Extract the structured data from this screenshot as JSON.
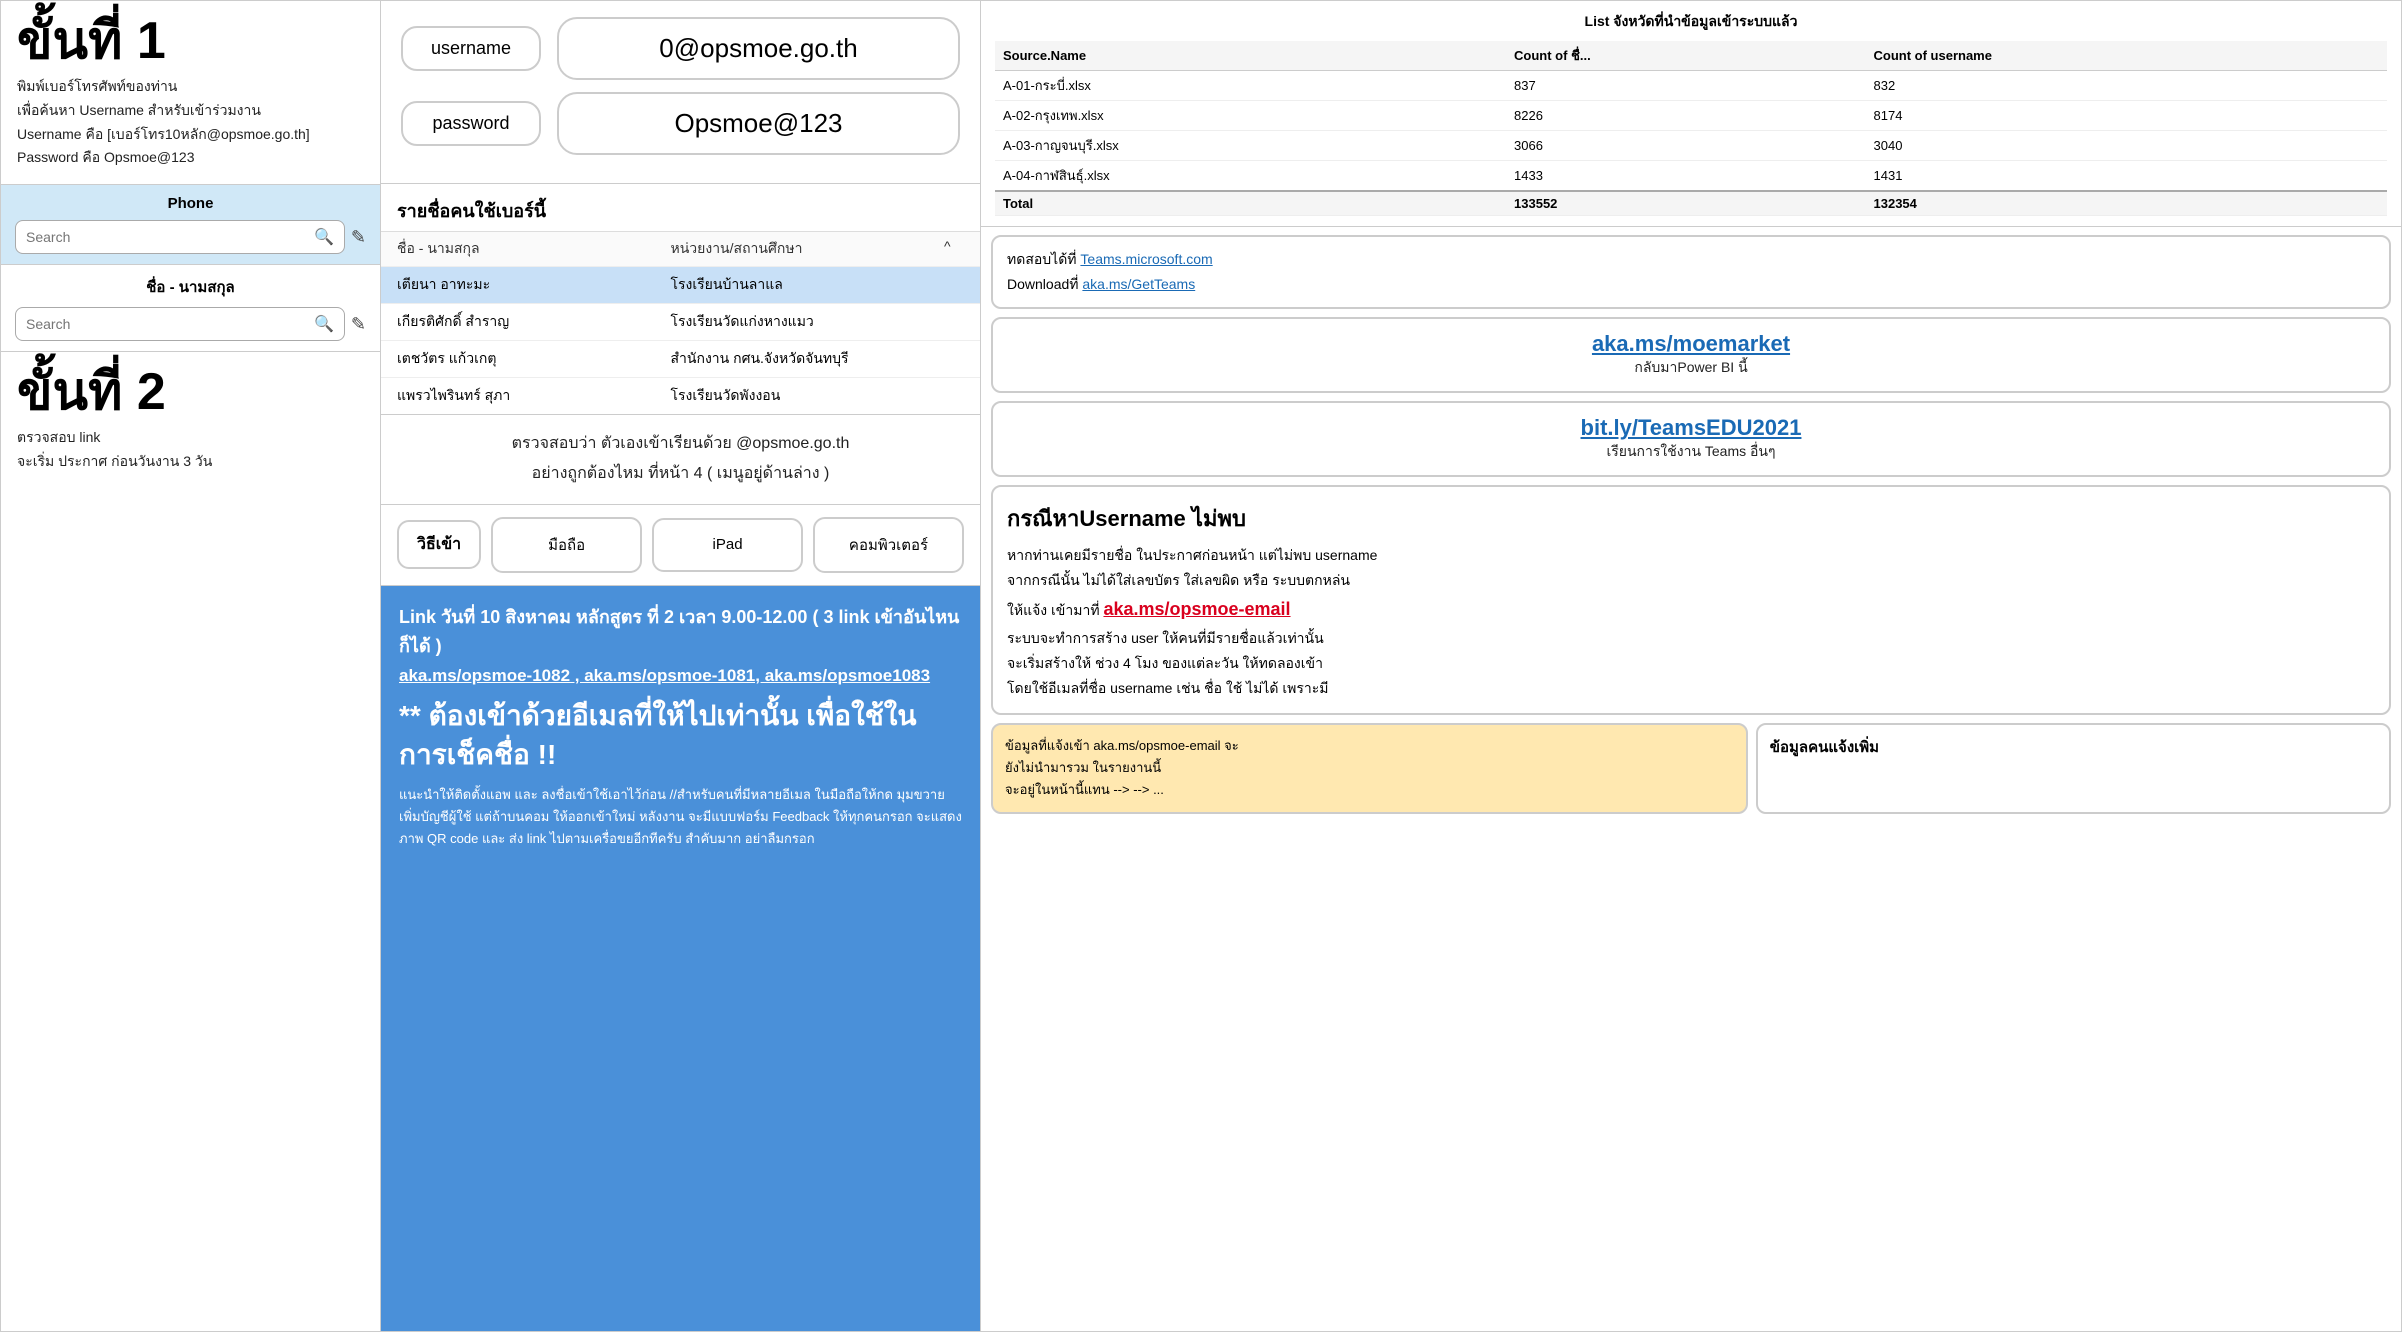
{
  "left": {
    "step1_title": "ขั้นที่ 1",
    "step1_desc_line1": "พิมพ์เบอร์โทรศัพท์ของท่าน",
    "step1_desc_line2": "เพื่อค้นหา Username สำหรับเข้าร่วมงาน",
    "step1_desc_line3": "Username คือ [เบอร์โทร10หลัก@opsmoe.go.th]",
    "step1_desc_line4": "Password คือ Opsmoe@123",
    "phone_label": "Phone",
    "phone_search_placeholder": "Search",
    "name_label": "ชื่อ - นามสกุล",
    "name_search_placeholder": "Search",
    "step2_title": "ขั้นที่ 2",
    "step2_desc_line1": "ตรวจสอบ link",
    "step2_desc_line2": "จะเริ่ม ประกาศ ก่อนวันงาน 3 วัน"
  },
  "mid": {
    "username_label": "username",
    "username_value": "0@opsmoe.go.th",
    "password_label": "password",
    "password_value": "Opsmoe@123",
    "user_list_title": "รายชื่อคนใช้เบอร์นี้",
    "col1": "ชื่อ - นามสกุล",
    "col2": "หน่วยงาน/สถานศึกษา",
    "users": [
      {
        "name": "เตียนา อาทะมะ",
        "org": "โรงเรียนบ้านลาแล",
        "active": true
      },
      {
        "name": "เกียรติศักดิ์ สำราญ",
        "org": "โรงเรียนวัดแก่งหางแมว",
        "active": false
      },
      {
        "name": "เตชวัตร แก้วเกตุ",
        "org": "สำนักงาน กศน.จังหวัดจันทบุรี",
        "active": false
      },
      {
        "name": "แพรวไพรินทร์ สุภา",
        "org": "โรงเรียนวัดพังงอน",
        "active": false
      }
    ],
    "verify_line1": "ตรวจสอบว่า ตัวเองเข้าเรียนด้วย @opsmoe.go.th",
    "verify_line2": "อย่างถูกต้องไหม ที่หน้า 4 ( เมนูอยู่ด้านล่าง )",
    "method_label": "วิธีเข้า",
    "method_mobile": "มือถือ",
    "method_ipad": "iPad",
    "method_computer": "คอมพิวเตอร์",
    "announce_line1": "Link วันที่ 10 สิงหาคม  หลักสูตร ที่ 2 เวลา 9.00-12.00 ( 3 link เข้าอันไหนก็ได้ )",
    "announce_links": "aka.ms/opsmoe-1082 , aka.ms/opsmoe-1081, aka.ms/opsmoe1083",
    "announce_big": "** ต้องเข้าด้วยอีเมลที่ให้ไปเท่านั้น เพื่อใช้ในการเช็คชื่อ !!",
    "announce_small": "แนะนำให้ติดตั้งแอพ และ ลงชื่อเข้าใช้เอาไว้ก่อน //สำหรับคนที่มีหลายอีเมล ในมือถือให้กด มุมขวาย เพิ่มบัญชีผู้ใช้ แต่ถ้าบนคอม ให้ออกเข้าใหม่\nหลังงาน จะมีแบบฟอร์ม Feedback ให้ทุกคนกรอก จะแสดงภาพ QR code และ ส่ง link ไปตามเครื่อขยอีกทีครับ สำคับมาก อย่าลืมกรอก"
  },
  "right": {
    "table_title": "List จังหวัดที่นำข้อมูลเข้าระบบแล้ว",
    "table_headers": [
      "Source.Name",
      "Count of ชื่...",
      "Count of username"
    ],
    "table_rows": [
      {
        "name": "A-01-กระบี่.xlsx",
        "count1": "837",
        "count2": "832"
      },
      {
        "name": "A-02-กรุงเทพ.xlsx",
        "count1": "8226",
        "count2": "8174"
      },
      {
        "name": "A-03-กาญจนบุรี.xlsx",
        "count1": "3066",
        "count2": "3040"
      },
      {
        "name": "A-04-กาฬสินธุ์.xlsx",
        "count1": "1433",
        "count2": "1431"
      }
    ],
    "table_total_label": "Total",
    "table_total_count1": "133552",
    "table_total_count2": "132354",
    "teams_line1": "ทดสอบได้ที่ ",
    "teams_link1": "Teams.microsoft.com",
    "teams_line2": "Downloadที่ ",
    "teams_link2": "aka.ms/GetTeams",
    "aka_link": "aka.ms/moemarket",
    "aka_sub": "กลับมาPower BI  นี้",
    "bit_link": "bit.ly/TeamsEDU2021",
    "bit_sub": "เรียนการใช้งาน Teams อื่นๆ",
    "username_title": "กรณีหาUsername ไม่พบ",
    "username_desc1": "หากท่านเคยมีรายชื่อ ในประกาศก่อนหน้า แต่ไม่พบ username",
    "username_desc2": "จากกรณีนั้น ไม่ได้ใส่เลขบัตร ใส่เลขผิด หรือ ระบบตกหล่น",
    "username_desc3": "ให้แจ้ง เข้ามาที่ ",
    "username_link": "aka.ms/opsmoe-email",
    "username_desc4": "ระบบจะทำการสร้าง user ให้คนที่มีรายชื่อแล้วเท่านั้น",
    "username_desc5": "จะเริ่มสร้างให้ ช่วง 4 โมง ของแต่ละวัน ให้ทดลองเข้า",
    "username_desc6": "โดยใช้อีเมลที่ชื่อ username เช่น ชื่อ ใช้ ไม่ได้ เพราะมี",
    "opsmoe_email_note1": "ข้อมูลที่แจ้งเข้า aka.ms/opsmoe-email จะ",
    "opsmoe_email_note2": "ยังไม่นำมารวม ในรายงานนี้",
    "opsmoe_email_note3": "จะอยู่ในหน้านี้แทน --> --> ...",
    "opsmoe_email_link": "aka.ms/opsmoe-email",
    "report_title": "ข้อมูลคนแจ้งเพิ่ม"
  }
}
